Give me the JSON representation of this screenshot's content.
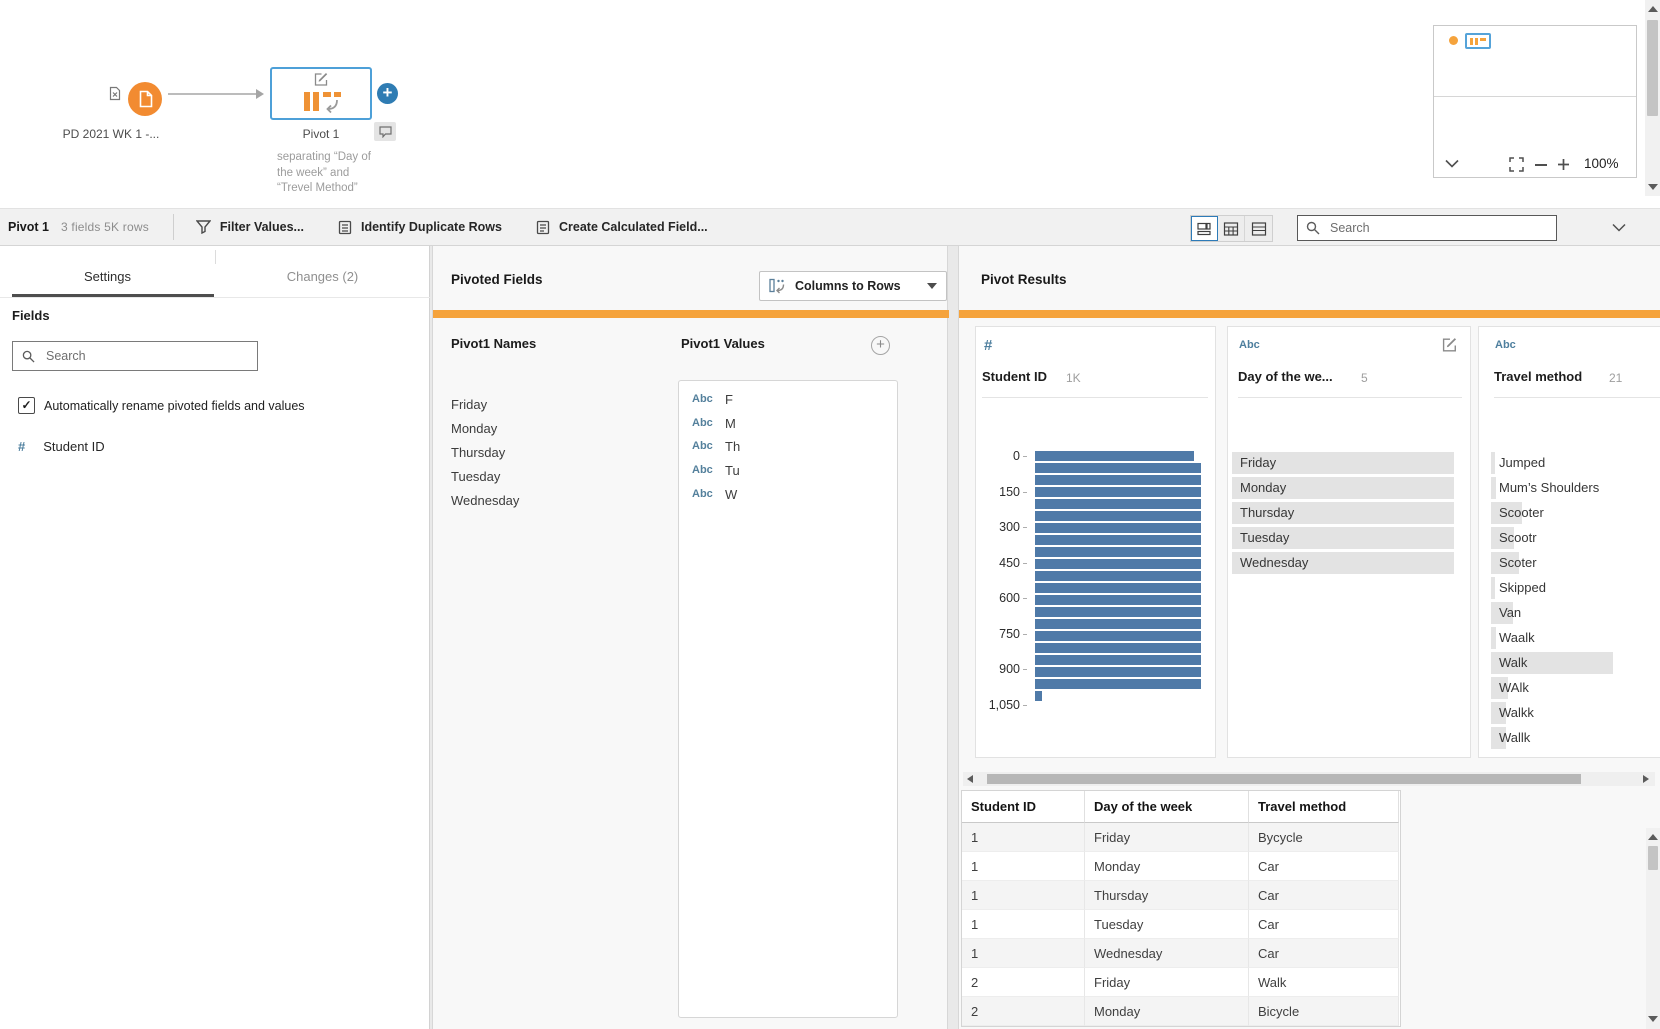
{
  "flow": {
    "input_node": {
      "label": "PD 2021 WK 1 -..."
    },
    "pivot_node": {
      "label": "Pivot 1",
      "annotation_lines": [
        "separating “Day of",
        "the week” and",
        "“Trevel Method”"
      ]
    },
    "navigator": {
      "zoom_level": "100%"
    }
  },
  "toolbar": {
    "node_name": "Pivot 1",
    "summary": "3 fields  5K rows",
    "actions": [
      "Filter Values...",
      "Identify Duplicate Rows",
      "Create Calculated Field..."
    ],
    "search_placeholder": "Search"
  },
  "left_panel": {
    "tabs": {
      "settings": "Settings",
      "changes": "Changes (2)"
    },
    "fields_label": "Fields",
    "search_placeholder": "Search",
    "auto_rename_label": "Automatically rename pivoted fields and values",
    "auto_rename_checked": true,
    "fields": [
      {
        "type": "#",
        "name": "Student ID"
      }
    ]
  },
  "pivoted_fields": {
    "title": "Pivoted Fields",
    "pivot_mode_button": "Columns to Rows",
    "names_header": "Pivot1 Names",
    "values_header": "Pivot1 Values",
    "names": [
      "Friday",
      "Monday",
      "Thursday",
      "Tuesday",
      "Wednesday"
    ],
    "values": [
      {
        "type": "Abc",
        "value": "F"
      },
      {
        "type": "Abc",
        "value": "M"
      },
      {
        "type": "Abc",
        "value": "Th"
      },
      {
        "type": "Abc",
        "value": "Tu"
      },
      {
        "type": "Abc",
        "value": "W"
      }
    ]
  },
  "pivot_results": {
    "title": "Pivot Results",
    "cards": [
      {
        "type": "#",
        "name": "Student ID",
        "count": "1K",
        "histogram": {
          "type": "bar",
          "y_ticks": [
            "0",
            "150",
            "300",
            "450",
            "600",
            "750",
            "900",
            "1,050"
          ],
          "bar_fractions": [
            0.96,
            1,
            1,
            1,
            1,
            1,
            1,
            1,
            1,
            1,
            1,
            1,
            1,
            1,
            1,
            1,
            1,
            1,
            1,
            1,
            0.04
          ]
        }
      },
      {
        "type": "Abc",
        "name": "Day of the we...",
        "count": "5",
        "values": [
          {
            "label": "Friday",
            "bar": 1
          },
          {
            "label": "Monday",
            "bar": 1
          },
          {
            "label": "Thursday",
            "bar": 1
          },
          {
            "label": "Tuesday",
            "bar": 1
          },
          {
            "label": "Wednesday",
            "bar": 1
          }
        ]
      },
      {
        "type": "Abc",
        "name": "Travel method",
        "count": "21",
        "values": [
          {
            "label": "Jumped",
            "bar": 0.03
          },
          {
            "label": "Mum’s Shoulders",
            "bar": 0.04
          },
          {
            "label": "Scooter",
            "bar": 0.25
          },
          {
            "label": "Scootr",
            "bar": 0.19
          },
          {
            "label": "Scoter",
            "bar": 0.23
          },
          {
            "label": "Skipped",
            "bar": 0.03
          },
          {
            "label": "Van",
            "bar": 0.18
          },
          {
            "label": "Waalk",
            "bar": 0.04
          },
          {
            "label": "Walk",
            "bar": 1
          },
          {
            "label": "WAlk",
            "bar": 0.14
          },
          {
            "label": "Walkk",
            "bar": 0.12
          },
          {
            "label": "Wallk",
            "bar": 0.12
          }
        ]
      }
    ]
  },
  "data_grid": {
    "headers": [
      "Student ID",
      "Day of the week",
      "Travel method"
    ],
    "rows": [
      [
        "1",
        "Friday",
        "Bycycle"
      ],
      [
        "1",
        "Monday",
        "Car"
      ],
      [
        "1",
        "Thursday",
        "Car"
      ],
      [
        "1",
        "Tuesday",
        "Car"
      ],
      [
        "1",
        "Wednesday",
        "Car"
      ],
      [
        "2",
        "Friday",
        "Walk"
      ],
      [
        "2",
        "Monday",
        "Bicycle"
      ]
    ]
  },
  "colors": {
    "accent_orange": "#f5a33c",
    "node_orange": "#f28b31",
    "selection_blue": "#4da0d8",
    "histogram_bar_blue": "#4f7aa8",
    "field_type_blue": "#4e7f9e",
    "value_bar_gray": "#e3e3e3"
  }
}
